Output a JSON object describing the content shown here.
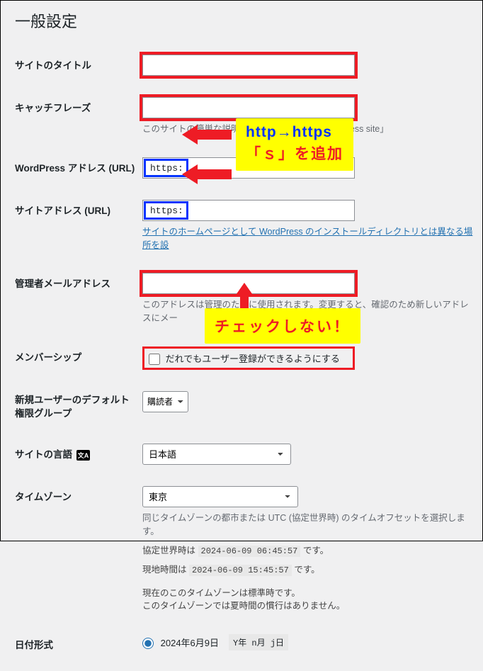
{
  "page_title": "一般設定",
  "fields": {
    "site_title": {
      "label": "サイトのタイトル",
      "value": ""
    },
    "tagline": {
      "label": "キャッチフレーズ",
      "value": "",
      "desc": "このサイトの簡単な説明。例:「Just another WordPress site」"
    },
    "wp_url": {
      "label": "WordPress アドレス (URL)",
      "prefix": "https:"
    },
    "site_url": {
      "label": "サイトアドレス (URL)",
      "prefix": "https:",
      "desc_link": "サイトのホームページとして WordPress のインストールディレクトリとは異なる場所を設"
    },
    "admin_email": {
      "label": "管理者メールアドレス",
      "value": "",
      "desc": "このアドレスは管理のために使用されます。変更すると、確認のため新しいアドレスにメー"
    },
    "membership": {
      "label": "メンバーシップ",
      "checkbox_label": "だれでもユーザー登録ができるようにする",
      "checked": false
    },
    "default_role": {
      "label": "新規ユーザーのデフォルト権限グループ",
      "value": "購読者"
    },
    "site_lang": {
      "label": "サイトの言語",
      "value": "日本語",
      "icon": "文A"
    },
    "timezone": {
      "label": "タイムゾーン",
      "value": "東京",
      "desc1": "同じタイムゾーンの都市または UTC (協定世界時) のタイムオフセットを選択します。",
      "utc_label": "協定世界時は",
      "utc_time": "2024-06-09 06:45:57",
      "utc_suffix": "です。",
      "local_label": "現地時間は",
      "local_time": "2024-06-09 15:45:57",
      "local_suffix": "です。",
      "std1": "現在のこのタイムゾーンは標準時です。",
      "std2": "このタイムゾーンでは夏時間の慣行はありません。"
    },
    "date_format": {
      "label": "日付形式",
      "sample": "2024年6月9日",
      "code": "Y年 n月 j日"
    }
  },
  "callouts": {
    "https": {
      "line1": "http→https",
      "line2": "「ｓ」を追加"
    },
    "nocheck": "チェックしない！"
  }
}
